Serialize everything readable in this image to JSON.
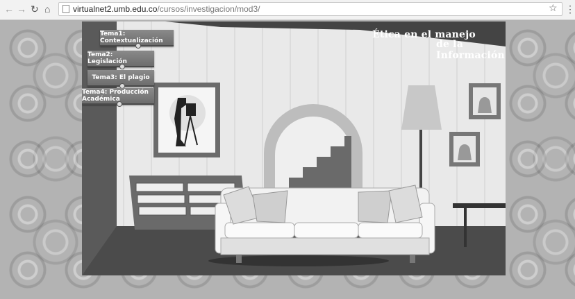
{
  "browser": {
    "url_domain": "virtualnet2.umb.edu.co",
    "url_path": "/cursos/investigacion/mod3/",
    "back_icon": "arrow-left",
    "forward_icon": "arrow-right",
    "reload_icon": "reload",
    "home_icon": "home",
    "bookmark_icon": "star",
    "menu_icon": "hamburger"
  },
  "header": {
    "title_line1": "Ética en el manejo",
    "title_line2": "de la Información"
  },
  "menu": {
    "items": [
      {
        "label": "Tema1: Contextualización"
      },
      {
        "label": "Tema2: Legislación"
      },
      {
        "label": "Tema3: El plagio"
      },
      {
        "label": "Tema4: Producción Académica"
      }
    ]
  },
  "colors": {
    "wall": "#e6e6e6",
    "floor": "#4a4a4a",
    "button": "#7a7a7a"
  }
}
